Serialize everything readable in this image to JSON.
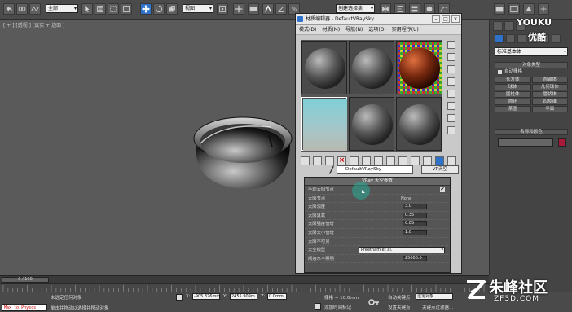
{
  "toolbar": {
    "selection_filter": "全部",
    "reference_coord": "视图",
    "named_selection": "创建选择集"
  },
  "viewport": {
    "label": "[ + ] [透视 ] [真实 + 边面 ]"
  },
  "command_panel": {
    "category_select": "标准基本体",
    "object_type_header": "对象类型",
    "autogrid_label": "自动栅格",
    "buttons": [
      [
        "长方体",
        "圆锥体"
      ],
      [
        "球体",
        "几何球体"
      ],
      [
        "圆柱体",
        "管状体"
      ],
      [
        "圆环",
        "四棱锥"
      ],
      [
        "茶壶",
        "平面"
      ]
    ],
    "name_color_header": "名称和颜色",
    "object_color": "#a81a3a"
  },
  "watermark": {
    "youku_text": "YOUKU",
    "youku_sub": "优酷",
    "site_name": "朱峰社区",
    "site_url": "ZF3D.COM"
  },
  "material_editor": {
    "title": "材质编辑器 - DefaultVRaySky",
    "menus": [
      "模式(D)",
      "材质(M)",
      "导航(N)",
      "选项(O)",
      "实用程序(U)"
    ],
    "material_name": "DefaultVRaySky",
    "material_type": "VR天空",
    "rollout_title": "VRay 天空参数",
    "params": [
      {
        "label": "手动太阳节点",
        "type": "check",
        "value": "✔"
      },
      {
        "label": "太阳节点",
        "type": "none",
        "value": "None"
      },
      {
        "label": "太阳浊度",
        "type": "num",
        "value": "3.0"
      },
      {
        "label": "太阳臭氧",
        "type": "num",
        "value": "0.35"
      },
      {
        "label": "太阳强度倍增",
        "type": "num",
        "value": "0.05"
      },
      {
        "label": "太阳大小倍增",
        "type": "num",
        "value": "1.0"
      },
      {
        "label": "太阳不可见",
        "type": "none",
        "value": ""
      },
      {
        "label": "天空模型",
        "type": "select",
        "value": "Preetham et al."
      },
      {
        "label": "间接水平照明",
        "type": "num",
        "value": "25000.0"
      }
    ]
  },
  "timeline": {
    "frame": "0 / 100"
  },
  "status": {
    "left_prompt": "未选定任何对象",
    "hint": "单击并拖动以选择并移动对象",
    "maxscript": "Max to Physcs",
    "x_label": "X:",
    "x_value": "-905.376mm",
    "y_label": "Y:",
    "y_value": "2455.909m",
    "z_label": "Z:",
    "z_value": "0.0mm",
    "grid": "栅格 = 10.0mm",
    "add_time_tag": "添加时间标记",
    "auto_key": "自动关键点",
    "selected_object": "选定对象",
    "set_key": "设置关键点",
    "key_filters": "关键点过滤器..."
  }
}
